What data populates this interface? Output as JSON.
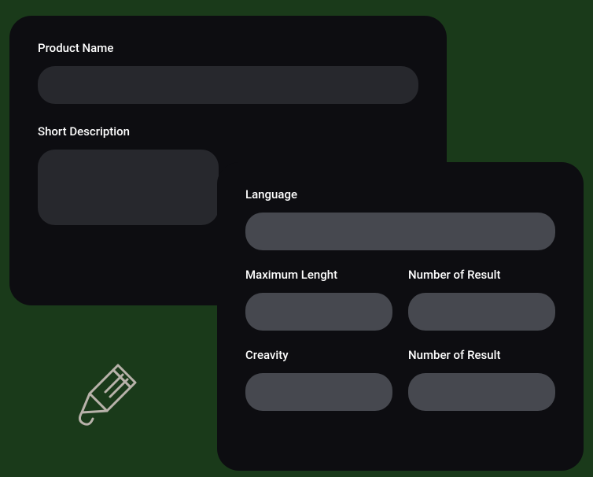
{
  "topCard": {
    "productName": {
      "label": "Product Name",
      "value": ""
    },
    "shortDescription": {
      "label": "Short Description",
      "value": ""
    }
  },
  "bottomCard": {
    "language": {
      "label": "Language",
      "value": ""
    },
    "maxLength": {
      "label": "Maximum Lenght",
      "value": ""
    },
    "numberOfResult1": {
      "label": "Number of Result",
      "value": ""
    },
    "creativity": {
      "label": "Creavity",
      "value": ""
    },
    "numberOfResult2": {
      "label": "Number of Result",
      "value": ""
    }
  }
}
